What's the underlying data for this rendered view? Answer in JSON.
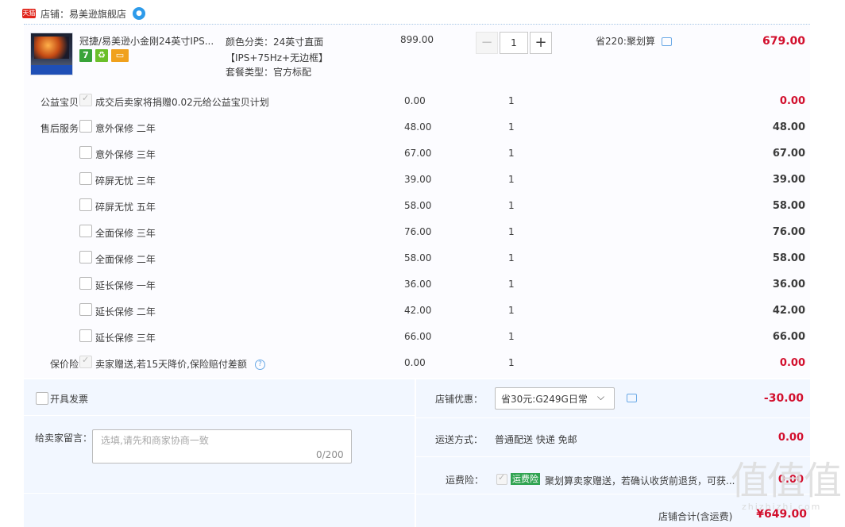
{
  "shop": {
    "tmall_badge": "天猫",
    "name": "店铺：易美逊旗舰店"
  },
  "product": {
    "title": "冠捷/易美逊小金刚24英寸IPS...",
    "sku_line": "颜色分类：24英寸直面【IPS+75Hz+无边框】",
    "package": "套餐类型：官方标配",
    "price": "899.00",
    "quantity": "1",
    "promo": "省220:聚划算",
    "total": "679.00",
    "badge_7": "7"
  },
  "stepper": {
    "minus": "−",
    "plus": "+"
  },
  "services": [
    {
      "category": "公益宝贝",
      "name": "成交后卖家将捐赠0.02元给公益宝贝计划",
      "price": "0.00",
      "qty": "1",
      "total": "0.00",
      "checked": true
    },
    {
      "category": "售后服务",
      "name": "意外保修 二年",
      "price": "48.00",
      "qty": "1",
      "total": "48.00",
      "checked": false
    },
    {
      "category": "",
      "name": "意外保修 三年",
      "price": "67.00",
      "qty": "1",
      "total": "67.00",
      "checked": false
    },
    {
      "category": "",
      "name": "碎屏无忧 三年",
      "price": "39.00",
      "qty": "1",
      "total": "39.00",
      "checked": false
    },
    {
      "category": "",
      "name": "碎屏无忧 五年",
      "price": "58.00",
      "qty": "1",
      "total": "58.00",
      "checked": false
    },
    {
      "category": "",
      "name": "全面保修 三年",
      "price": "76.00",
      "qty": "1",
      "total": "76.00",
      "checked": false
    },
    {
      "category": "",
      "name": "全面保修 二年",
      "price": "58.00",
      "qty": "1",
      "total": "58.00",
      "checked": false
    },
    {
      "category": "",
      "name": "延长保修 一年",
      "price": "36.00",
      "qty": "1",
      "total": "36.00",
      "checked": false
    },
    {
      "category": "",
      "name": "延长保修 二年",
      "price": "42.00",
      "qty": "1",
      "total": "42.00",
      "checked": false
    },
    {
      "category": "",
      "name": "延长保修 三年",
      "price": "66.00",
      "qty": "1",
      "total": "66.00",
      "checked": false
    },
    {
      "category": "保价险",
      "name": "卖家赠送,若15天降价,保险赔付差额",
      "price": "0.00",
      "qty": "1",
      "total": "0.00",
      "checked": true,
      "help": "?"
    }
  ],
  "invoice": {
    "label": "开具发票"
  },
  "message": {
    "label": "给卖家留言：",
    "placeholder": "选填,请先和商家协商一致",
    "counter": "0/200"
  },
  "discount": {
    "label": "店铺优惠：",
    "value": "省30元:G249G日常",
    "chevron": "⌵",
    "amount": "-30.00"
  },
  "shipping": {
    "label": "运送方式：",
    "value": "普通配送 快递 免邮",
    "amount": "0.00"
  },
  "freight_insurance": {
    "label": "运费险：",
    "badge": "运费险",
    "desc": "聚划算卖家赠送，若确认收货前退货，可获...",
    "amount": "0.00"
  },
  "total": {
    "label": "店铺合计(含运费)",
    "amount": "¥649.00"
  },
  "watermark": {
    "glyphs": "值值值",
    "url": "zhizhizhi.com"
  },
  "colors": {
    "price_red": "#d20f2d",
    "panel_bg": "#f2f7ff",
    "link_blue": "#6aa9e6",
    "tmall_red": "#e1251b",
    "green": "#31a452"
  }
}
